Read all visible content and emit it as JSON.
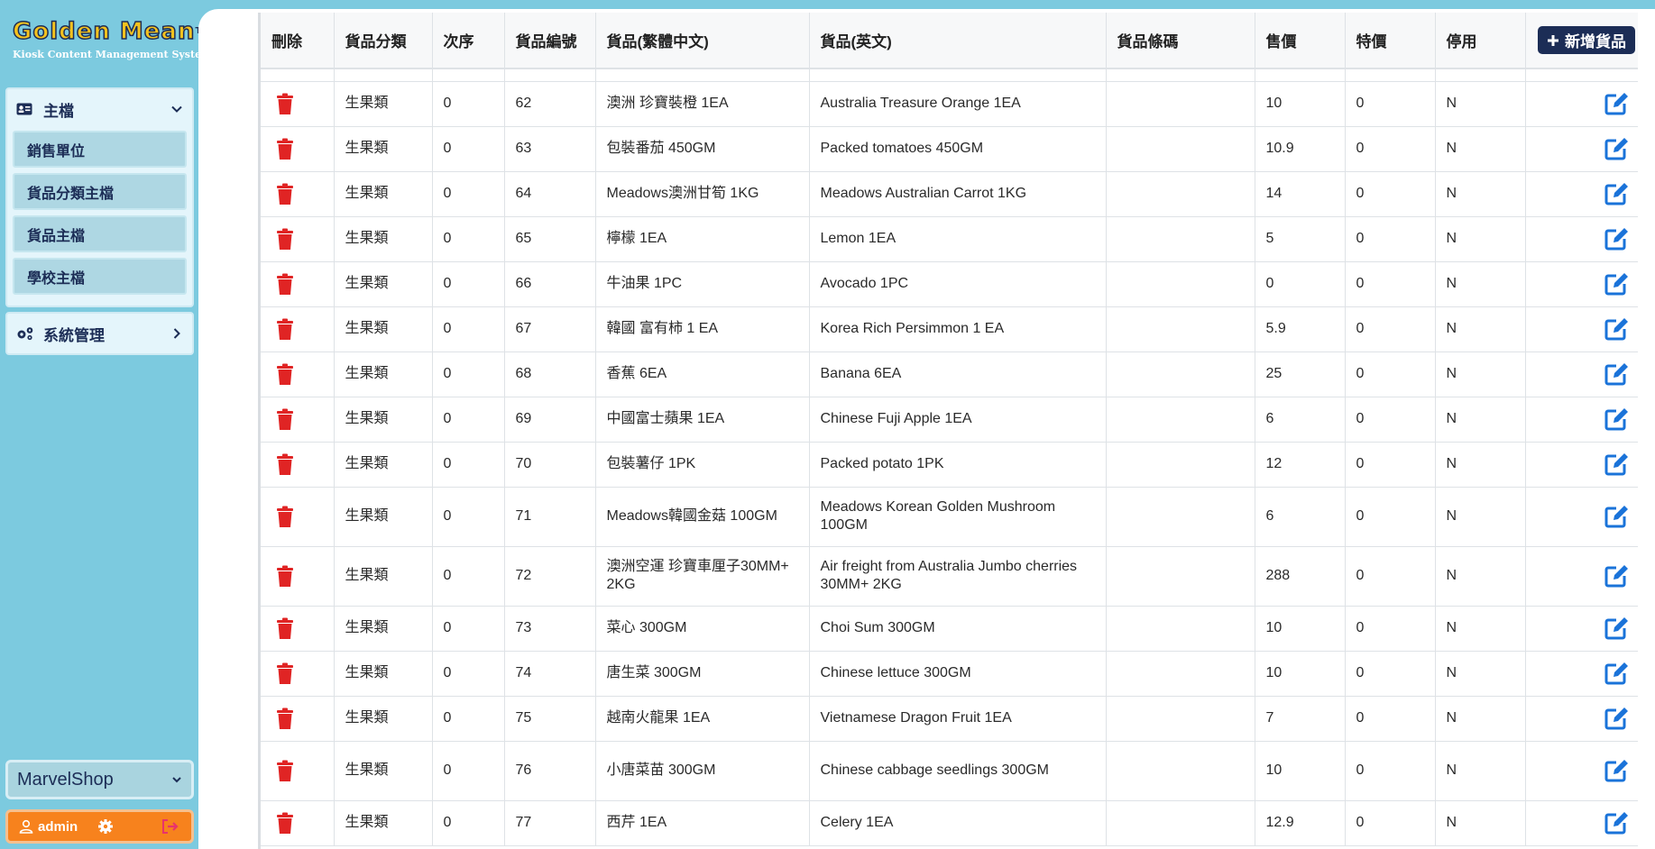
{
  "brand": {
    "logo_text": "Golden Mean",
    "tm": "TM",
    "subtitle": "Kiosk Content Management System"
  },
  "sidebar": {
    "main_group": {
      "label": "主檔",
      "items": [
        "銷售單位",
        "貨品分類主檔",
        "貨品主檔",
        "學校主檔"
      ]
    },
    "system_group": {
      "label": "系統管理"
    },
    "shop": "MarvelShop",
    "user": "admin"
  },
  "table": {
    "headers": [
      "刪除",
      "貨品分類",
      "次序",
      "貨品編號",
      "貨品(繁體中文)",
      "貨品(英文)",
      "貨品條碼",
      "售價",
      "特價",
      "停用"
    ],
    "add_button": "新增貨品",
    "rows": [
      {
        "category": "生果類",
        "order": "0",
        "code": "62",
        "name_zh": "澳洲 珍寶裝橙 1EA",
        "name_en": "Australia Treasure Orange 1EA",
        "barcode": "",
        "price": "10",
        "special": "0",
        "disabled": "N"
      },
      {
        "category": "生果類",
        "order": "0",
        "code": "63",
        "name_zh": "包裝番茄 450GM",
        "name_en": "Packed tomatoes 450GM",
        "barcode": "",
        "price": "10.9",
        "special": "0",
        "disabled": "N"
      },
      {
        "category": "生果類",
        "order": "0",
        "code": "64",
        "name_zh": "Meadows澳洲甘筍 1KG",
        "name_en": "Meadows Australian Carrot 1KG",
        "barcode": "",
        "price": "14",
        "special": "0",
        "disabled": "N"
      },
      {
        "category": "生果類",
        "order": "0",
        "code": "65",
        "name_zh": "檸檬 1EA",
        "name_en": "Lemon 1EA",
        "barcode": "",
        "price": "5",
        "special": "0",
        "disabled": "N"
      },
      {
        "category": "生果類",
        "order": "0",
        "code": "66",
        "name_zh": "牛油果 1PC",
        "name_en": "Avocado 1PC",
        "barcode": "",
        "price": "0",
        "special": "0",
        "disabled": "N"
      },
      {
        "category": "生果類",
        "order": "0",
        "code": "67",
        "name_zh": "韓國 富有柿 1 EA",
        "name_en": "Korea Rich Persimmon 1 EA",
        "barcode": "",
        "price": "5.9",
        "special": "0",
        "disabled": "N"
      },
      {
        "category": "生果類",
        "order": "0",
        "code": "68",
        "name_zh": "香蕉 6EA",
        "name_en": "Banana 6EA",
        "barcode": "",
        "price": "25",
        "special": "0",
        "disabled": "N"
      },
      {
        "category": "生果類",
        "order": "0",
        "code": "69",
        "name_zh": "中國富士蘋果 1EA",
        "name_en": "Chinese Fuji Apple 1EA",
        "barcode": "",
        "price": "6",
        "special": "0",
        "disabled": "N"
      },
      {
        "category": "生果類",
        "order": "0",
        "code": "70",
        "name_zh": "包裝薯仔 1PK",
        "name_en": "Packed potato 1PK",
        "barcode": "",
        "price": "12",
        "special": "0",
        "disabled": "N"
      },
      {
        "category": "生果類",
        "order": "0",
        "code": "71",
        "name_zh": "Meadows韓國金菇 100GM",
        "name_en": "Meadows Korean Golden Mushroom 100GM",
        "barcode": "",
        "price": "6",
        "special": "0",
        "disabled": "N"
      },
      {
        "category": "生果類",
        "order": "0",
        "code": "72",
        "name_zh": "澳洲空運 珍寶車厘子30MM+ 2KG",
        "name_en": "Air freight from Australia Jumbo cherries 30MM+ 2KG",
        "barcode": "",
        "price": "288",
        "special": "0",
        "disabled": "N"
      },
      {
        "category": "生果類",
        "order": "0",
        "code": "73",
        "name_zh": "菜心 300GM",
        "name_en": "Choi Sum 300GM",
        "barcode": "",
        "price": "10",
        "special": "0",
        "disabled": "N"
      },
      {
        "category": "生果類",
        "order": "0",
        "code": "74",
        "name_zh": "唐生菜 300GM",
        "name_en": "Chinese lettuce 300GM",
        "barcode": "",
        "price": "10",
        "special": "0",
        "disabled": "N"
      },
      {
        "category": "生果類",
        "order": "0",
        "code": "75",
        "name_zh": "越南火龍果 1EA",
        "name_en": "Vietnamese Dragon Fruit 1EA",
        "barcode": "",
        "price": "7",
        "special": "0",
        "disabled": "N"
      },
      {
        "category": "生果類",
        "order": "0",
        "code": "76",
        "name_zh": "小唐菜苗 300GM",
        "name_en": "Chinese cabbage seedlings 300GM",
        "barcode": "",
        "price": "10",
        "special": "0",
        "disabled": "N"
      },
      {
        "category": "生果類",
        "order": "0",
        "code": "77",
        "name_zh": "西芹 1EA",
        "name_en": "Celery 1EA",
        "barcode": "",
        "price": "12.9",
        "special": "0",
        "disabled": "N"
      }
    ]
  },
  "colors": {
    "sidebar_bg": "#7ccadf",
    "navy": "#1c2d56",
    "trash_red": "#e02424",
    "edit_blue": "#1a73d9",
    "user_orange": "#f7821d"
  },
  "icons": {
    "delete": "trash-icon",
    "edit": "edit-icon",
    "add": "plus-icon",
    "main": "id-card-icon",
    "system": "gears-icon",
    "user": "user-icon",
    "settings": "gear-icon",
    "logout": "logout-icon"
  }
}
